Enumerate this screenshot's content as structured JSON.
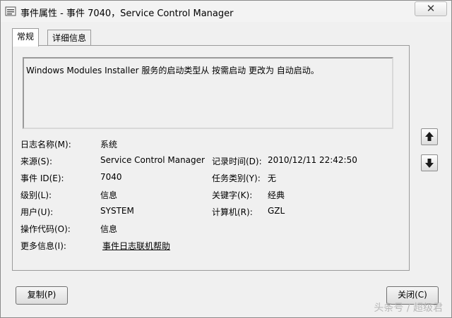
{
  "window": {
    "title": "事件属性 - 事件 7040，Service Control Manager",
    "close_glyph": "✕"
  },
  "tabs": [
    {
      "label": "常规",
      "selected": true
    },
    {
      "label": "详细信息",
      "selected": false
    }
  ],
  "description": "Windows Modules Installer 服务的启动类型从 按需启动 更改为 自动启动。",
  "fields": {
    "log_name": {
      "label": "日志名称(M):",
      "value": "系统"
    },
    "source": {
      "label": "来源(S):",
      "value": "Service Control Manager"
    },
    "logged": {
      "label": "记录时间(D):",
      "value": "2010/12/11 22:42:50"
    },
    "event_id": {
      "label": "事件 ID(E):",
      "value": "7040"
    },
    "task_category": {
      "label": "任务类别(Y):",
      "value": "无"
    },
    "level": {
      "label": "级别(L):",
      "value": "信息"
    },
    "keywords": {
      "label": "关键字(K):",
      "value": "经典"
    },
    "user": {
      "label": "用户(U):",
      "value": "SYSTEM"
    },
    "computer": {
      "label": "计算机(R):",
      "value": "GZL"
    },
    "opcode": {
      "label": "操作代码(O):",
      "value": "信息"
    },
    "more_info": {
      "label": "更多信息(I):",
      "value": "事件日志联机帮助"
    }
  },
  "buttons": {
    "copy": "复制(P)",
    "close": "关闭(C)"
  },
  "icons": {
    "app": "event-viewer-icon",
    "up": "arrow-up-icon",
    "down": "arrow-down-icon"
  },
  "watermark": "头条号 / 超级君",
  "colors": {
    "window_bg": "#f0f0f0",
    "border": "#9a9a9a"
  }
}
